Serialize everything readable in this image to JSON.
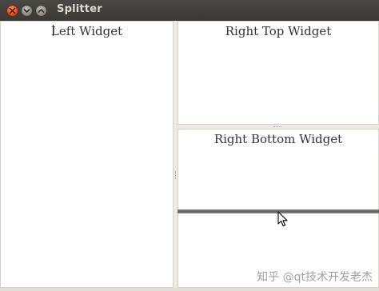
{
  "window": {
    "title": "Splitter",
    "buttons": {
      "close_icon": "close-icon",
      "minimize_icon": "minimize-icon",
      "maximize_icon": "maximize-icon"
    }
  },
  "panels": {
    "left": {
      "label": "Left Widget"
    },
    "right_top": {
      "label": "Right Top Widget"
    },
    "right_bottom": {
      "label": "Right Bottom Widget"
    }
  },
  "overlay": {
    "watermark": "知乎 @qt技术开发老杰"
  },
  "colors": {
    "titlebar": "#3a3835",
    "close_button": "#e0501e",
    "panel_background": "#ffffff",
    "splitter": "#ede9e3",
    "drag_line": "#6f6f6f"
  }
}
